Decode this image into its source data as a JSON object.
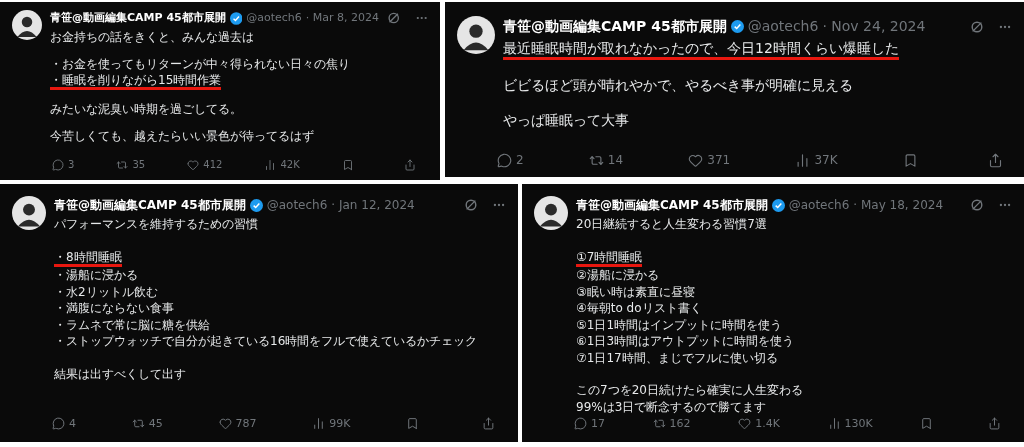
{
  "posts": [
    {
      "author": "青笹@動画編集CAMP 45都市展開",
      "handle": "@aotech6",
      "date": "· Mar 8, 2024",
      "paragraphs": [
        {
          "lines": [
            {
              "text": "お金持ちの話をきくと、みんな過去は",
              "underlined": false
            }
          ]
        },
        {
          "lines": [
            {
              "text": "・お金を使ってもリターンが中々得られない日々の焦り",
              "underlined": false
            },
            {
              "text": "・睡眠を削りながら15時間作業",
              "underlined": true
            }
          ]
        },
        {
          "lines": [
            {
              "text": "みたいな泥臭い時期を過ごしてる。",
              "underlined": false
            }
          ]
        },
        {
          "lines": [
            {
              "text": "今苦しくても、越えたらいい景色が待ってるはず",
              "underlined": false
            }
          ]
        }
      ],
      "actions": [
        {
          "kind": "reply",
          "count": "3"
        },
        {
          "kind": "repost",
          "count": "35"
        },
        {
          "kind": "like",
          "count": "412"
        },
        {
          "kind": "views",
          "count": "42K"
        },
        {
          "kind": "bookmark"
        },
        {
          "kind": "share"
        }
      ]
    },
    {
      "author": "青笹@動画編集CAMP 45都市展開",
      "handle": "@aotech6",
      "date": "· Nov 24, 2024",
      "paragraphs": [
        {
          "lines": [
            {
              "text": "最近睡眠時間が取れなかったので、今日12時間くらい爆睡した",
              "underlined": true
            }
          ]
        },
        {
          "lines": [
            {
              "text": "ビビるほど頭が晴れやかで、やるべき事が明確に見える",
              "underlined": false
            }
          ]
        },
        {
          "lines": [
            {
              "text": "やっぱ睡眠って大事",
              "underlined": false
            }
          ]
        }
      ],
      "actions": [
        {
          "kind": "reply",
          "count": "2"
        },
        {
          "kind": "repost",
          "count": "14"
        },
        {
          "kind": "like",
          "count": "371"
        },
        {
          "kind": "views",
          "count": "37K"
        },
        {
          "kind": "bookmark"
        },
        {
          "kind": "share"
        }
      ]
    },
    {
      "author": "青笹@動画編集CAMP 45都市展開",
      "handle": "@aotech6",
      "date": "· Jan 12, 2024",
      "paragraphs": [
        {
          "lines": [
            {
              "text": "パフォーマンスを維持するための習慣",
              "underlined": false
            }
          ]
        },
        {
          "lines": [
            {
              "text": "・8時間睡眠",
              "underlined": true
            },
            {
              "text": "・湯船に浸かる",
              "underlined": false
            },
            {
              "text": "・水2リットル飲む",
              "underlined": false
            },
            {
              "text": "・満腹にならない食事",
              "underlined": false
            },
            {
              "text": "・ラムネで常に脳に糖を供給",
              "underlined": false
            },
            {
              "text": "・ストップウォッチで自分が起きている16時間をフルで使えているかチェック",
              "underlined": false
            }
          ]
        },
        {
          "lines": [
            {
              "text": "結果は出すべくして出す",
              "underlined": false
            }
          ]
        }
      ],
      "actions": [
        {
          "kind": "reply",
          "count": "4"
        },
        {
          "kind": "repost",
          "count": "45"
        },
        {
          "kind": "like",
          "count": "787"
        },
        {
          "kind": "views",
          "count": "99K"
        },
        {
          "kind": "bookmark"
        },
        {
          "kind": "share"
        }
      ]
    },
    {
      "author": "青笹@動画編集CAMP 45都市展開",
      "handle": "@aotech6",
      "date": "· May 18, 2024",
      "paragraphs": [
        {
          "lines": [
            {
              "text": "20日継続すると人生変わる習慣7選",
              "underlined": false
            }
          ]
        },
        {
          "lines": [
            {
              "text": "①7時間睡眠",
              "underlined": true
            },
            {
              "text": "②湯船に浸かる",
              "underlined": false
            },
            {
              "text": "③眠い時は素直に昼寝",
              "underlined": false
            },
            {
              "text": "④毎朝to doリスト書く",
              "underlined": false
            },
            {
              "text": "⑤1日1時間はインプットに時間を使う",
              "underlined": false
            },
            {
              "text": "⑥1日3時間はアウトプットに時間を使う",
              "underlined": false
            },
            {
              "text": "⑦1日17時間、まじでフルに使い切る",
              "underlined": false
            }
          ]
        },
        {
          "lines": [
            {
              "text": "この7つを20日続けたら確実に人生変わる",
              "underlined": false
            },
            {
              "text": "99%は3日で断念するので勝てます",
              "underlined": false
            }
          ]
        }
      ],
      "actions": [
        {
          "kind": "reply",
          "count": "17"
        },
        {
          "kind": "repost",
          "count": "162"
        },
        {
          "kind": "like",
          "count": "1.4K"
        },
        {
          "kind": "views",
          "count": "130K"
        },
        {
          "kind": "bookmark"
        },
        {
          "kind": "share"
        }
      ]
    }
  ]
}
